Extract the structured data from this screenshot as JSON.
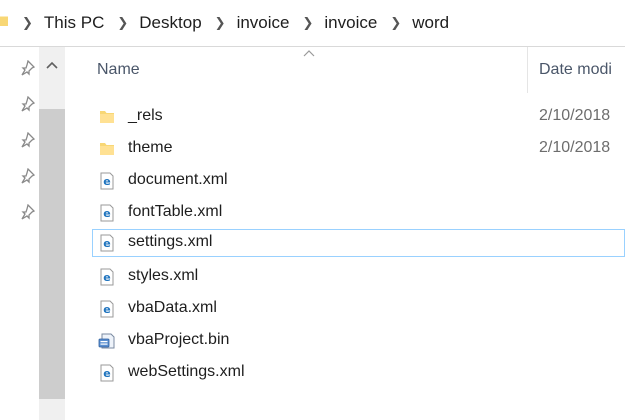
{
  "breadcrumb": {
    "items": [
      "This PC",
      "Desktop",
      "invoice",
      "invoice",
      "word"
    ]
  },
  "columns": {
    "name": "Name",
    "date_modified": "Date modi"
  },
  "files": [
    {
      "name": "_rels",
      "date": "2/10/2018",
      "icon": "folder-icon"
    },
    {
      "name": "theme",
      "date": "2/10/2018",
      "icon": "folder-icon"
    },
    {
      "name": "document.xml",
      "date": "",
      "icon": "xml-file-icon"
    },
    {
      "name": "fontTable.xml",
      "date": "",
      "icon": "xml-file-icon"
    },
    {
      "name": "settings.xml",
      "date": "",
      "icon": "xml-file-icon",
      "selected": true
    },
    {
      "name": "styles.xml",
      "date": "",
      "icon": "xml-file-icon"
    },
    {
      "name": "vbaData.xml",
      "date": "",
      "icon": "xml-file-icon"
    },
    {
      "name": "vbaProject.bin",
      "date": "",
      "icon": "bin-file-icon"
    },
    {
      "name": "webSettings.xml",
      "date": "",
      "icon": "xml-file-icon"
    }
  ],
  "colors": {
    "folder": "#f8d775",
    "ie_blue": "#1e73be",
    "selection_border": "#99d1ff",
    "header_text": "#4a5669"
  }
}
